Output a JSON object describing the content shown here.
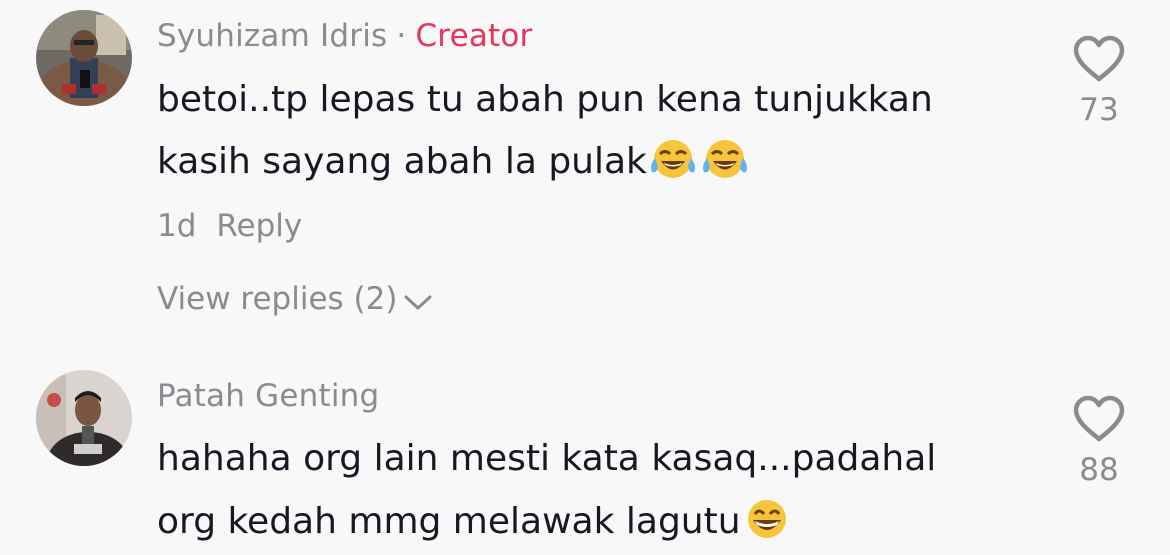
{
  "comments": [
    {
      "author": "Syuhizam Idris",
      "separator": "·",
      "badge": "Creator",
      "line1": "betoi..tp lepas tu abah pun kena tunjukkan",
      "line2": "kasih sayang abah la pulak",
      "emojis": [
        "face-with-tears-of-joy",
        "face-with-tears-of-joy"
      ],
      "time": "1d",
      "reply_label": "Reply",
      "view_replies": "View replies (2)",
      "likes": "73"
    },
    {
      "author": "Patah Genting",
      "line1": "hahaha org lain mesti kata kasaq...padahal",
      "line2": "org kedah mmg melawak lagutu",
      "emojis": [
        "grinning-face"
      ],
      "likes": "88"
    }
  ],
  "colors": {
    "background": "#f8f8f8",
    "text": "#161823",
    "secondary": "#8a8b91",
    "creator_badge": "#e8335a"
  }
}
